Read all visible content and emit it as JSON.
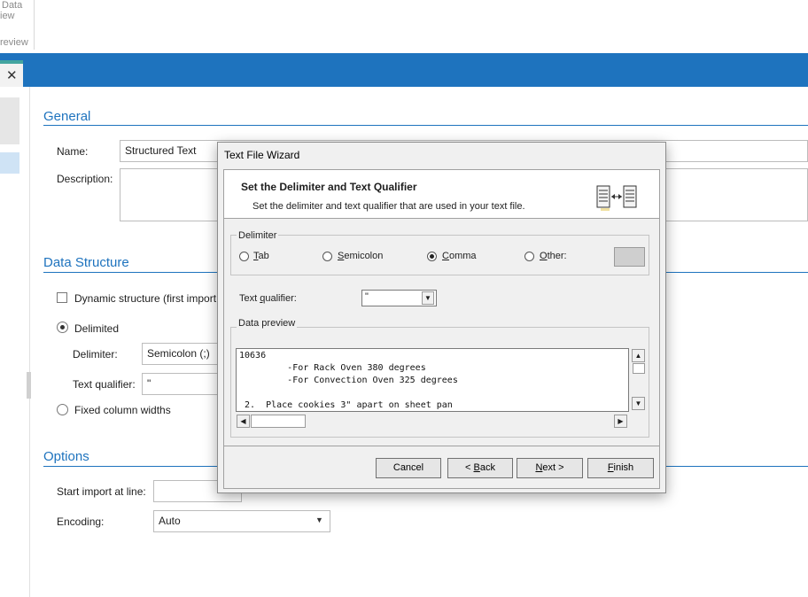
{
  "ribbon": {
    "group_label_line1": "Data",
    "group_label_line2": "iew",
    "group_caption": "review"
  },
  "window": {
    "close_glyph": "✕"
  },
  "general": {
    "section_title": "General",
    "name_label": "Name:",
    "name_value": "Structured Text",
    "description_label": "Description:",
    "description_value": ""
  },
  "data_structure": {
    "section_title": "Data Structure",
    "dynamic_label": "Dynamic structure (first import",
    "delimited_label": "Delimited",
    "delimiter_label": "Delimiter:",
    "delimiter_value": "Semicolon (;)",
    "qualifier_label": "Text qualifier:",
    "qualifier_value": "\"",
    "fixed_label": "Fixed column widths"
  },
  "options": {
    "section_title": "Options",
    "start_label": "Start import at line:",
    "start_value": "",
    "encoding_label": "Encoding:",
    "encoding_value": "Auto"
  },
  "wizard": {
    "title": "Text File Wizard",
    "heading": "Set the Delimiter and Text Qualifier",
    "subheading": "Set the delimiter and text qualifier that are used in your text file.",
    "icon": "columns-split-icon",
    "delimiter_group": "Delimiter",
    "options": [
      {
        "key": "T",
        "rest": "ab"
      },
      {
        "key": "S",
        "rest": "emicolon"
      },
      {
        "key": "C",
        "rest": "omma"
      },
      {
        "key": "O",
        "rest": "ther:"
      }
    ],
    "selected_option": "Comma",
    "other_value": "",
    "qualifier_label_pre": "Text ",
    "qualifier_label_key": "q",
    "qualifier_label_post": "ualifier:",
    "qualifier_value": "\"",
    "preview_group": "Data preview",
    "preview_lines": [
      "10636",
      "         -For Rack Oven 380 degrees",
      "         -For Convection Oven 325 degrees",
      "",
      " 2.  Place cookies 3\" apart on sheet pan"
    ],
    "buttons": {
      "cancel": "Cancel",
      "back_pre": "< ",
      "back_key": "B",
      "back_post": "ack",
      "next_key": "N",
      "next_post": "ext >",
      "finish_key": "F",
      "finish_post": "inish"
    }
  },
  "colors": {
    "accent": "#1e73be",
    "title_bar": "#1e73be",
    "dialog_bg": "#f0f0f0"
  }
}
